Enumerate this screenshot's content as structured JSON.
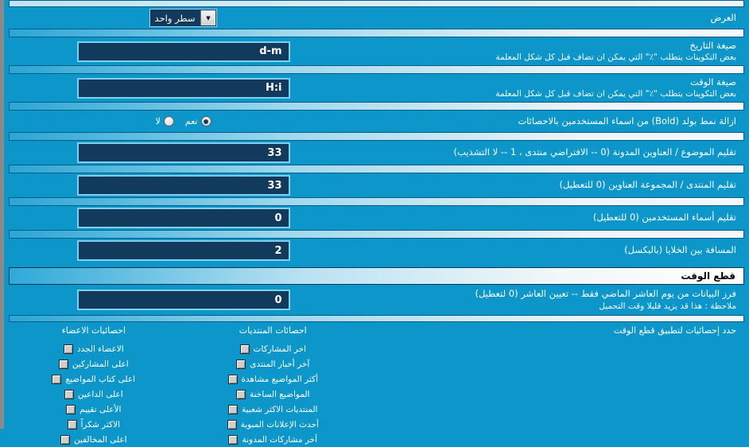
{
  "display_row": {
    "label": "العرض",
    "select_value": "سطر واحد",
    "arrow_icon": "chevron-down-icon"
  },
  "rows": [
    {
      "title": "صيغة التاريخ",
      "hint": "بعض التكوينات يتطلب \"٪\" التي يمكن ان تضاف قبل كل شكل المعلمة",
      "value": "d-m"
    },
    {
      "title": "صيغة الوقت",
      "hint": "بعض التكوينات يتطلب \"٪\" التي يمكن ان تضاف قبل كل شكل المعلمة",
      "value": "H:i"
    }
  ],
  "bold_row": {
    "title": "ازالة نمط بولد (Bold) من اسماء المستخدمين بالاحصائات",
    "options": [
      {
        "label": "نعم",
        "selected": true
      },
      {
        "label": "لا",
        "selected": false
      }
    ]
  },
  "number_rows": [
    {
      "title": "تقليم الموضوع / العناوين المدونة (0 -- الافتراضي منتدى ، 1 -- لا التشذيب)",
      "value": "33"
    },
    {
      "title": "تقليم المنتدى / المجموعة العناوين (0 للتعطيل)",
      "value": "33"
    },
    {
      "title": "تقليم أسماء المستخدمين (0 للتعطيل)",
      "value": "0"
    },
    {
      "title": "المسافة بين الخلايا (بالبكسل)",
      "value": "2"
    }
  ],
  "section": {
    "title": "قطع الوقت"
  },
  "cutoff_row": {
    "title": "فرز البيانات من يوم العاشر الماضي فقط -- تعيين العاشر (0 لتعطيل)",
    "hint": "ملاحظة : هذا قد يزيد قليلا وقت التحميل",
    "value": "0"
  },
  "columns": {
    "right_header": "حدد إحصائيات لتطبيق قطع الوقت",
    "middle_header": "احصائات المنتديات",
    "left_header": "احصائيات الاعضاء",
    "middle_items": [
      {
        "label": "اخر المشاركات",
        "checked": false
      },
      {
        "label": "آخر أخبار المنتدى",
        "checked": false
      },
      {
        "label": "أكثر المواضيع مشاهدة",
        "checked": false
      },
      {
        "label": "المواضيع الساخنة",
        "checked": false
      },
      {
        "label": "المنتديات الاكثر شعبية",
        "checked": false
      },
      {
        "label": "أحدث الإعلانات المبوبة",
        "checked": false
      },
      {
        "label": "أخر مشاركات المدونة",
        "checked": false
      }
    ],
    "left_items": [
      {
        "label": "الاعضاء الجدد",
        "checked": false
      },
      {
        "label": "اعلى المشاركين",
        "checked": false
      },
      {
        "label": "اعلى كتاب المواضيع",
        "checked": false
      },
      {
        "label": "اعلى الداعين",
        "checked": false
      },
      {
        "label": "الأعلى تقييم",
        "checked": false
      },
      {
        "label": "الاكثر شكراً",
        "checked": false
      },
      {
        "label": "اعلى المخالفين",
        "checked": false
      }
    ]
  },
  "colors": {
    "background": "#0d96ca",
    "input_bg": "#123a5c",
    "input_border": "#7fd0ee",
    "text": "#ffffff",
    "section_text": "#000000"
  }
}
